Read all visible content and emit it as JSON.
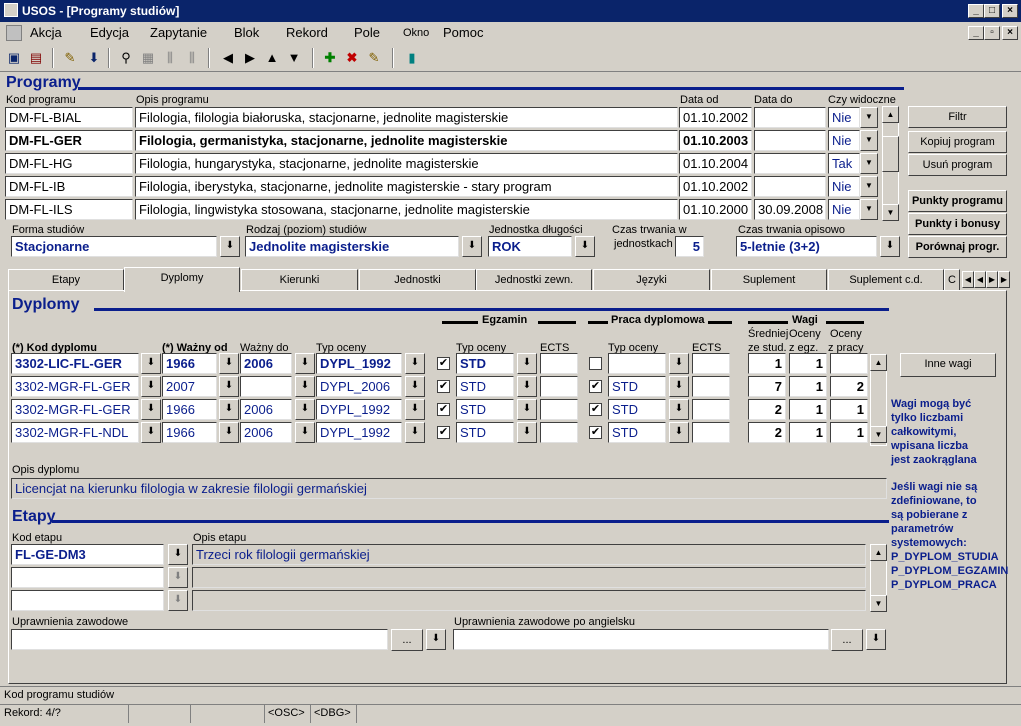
{
  "window": {
    "title": "USOS - [Programy studiów]"
  },
  "menu": [
    "Akcja",
    "Edycja",
    "Zapytanie",
    "Blok",
    "Rekord",
    "Pole",
    "Okno",
    "Pomoc"
  ],
  "programy": {
    "title": "Programy",
    "col_kod": "Kod programu",
    "col_opis": "Opis programu",
    "col_data_od": "Data od",
    "col_data_do": "Data do",
    "col_widoczne": "Czy widoczne",
    "rows": [
      {
        "kod": "DM-FL-BIAL",
        "opis": "Filologia, filologia białoruska, stacjonarne, jednolite magisterskie",
        "od": "01.10.2002",
        "do": "",
        "wid": "Nie"
      },
      {
        "kod": "DM-FL-GER",
        "opis": "Filologia, germanistyka, stacjonarne, jednolite magisterskie",
        "od": "01.10.2003",
        "do": "",
        "wid": "Nie"
      },
      {
        "kod": "DM-FL-HG",
        "opis": "Filologia, hungarystyka, stacjonarne, jednolite magisterskie",
        "od": "01.10.2004",
        "do": "",
        "wid": "Tak"
      },
      {
        "kod": "DM-FL-IB",
        "opis": "Filologia, iberystyka, stacjonarne, jednolite magisterskie - stary program",
        "od": "01.10.2002",
        "do": "",
        "wid": "Nie"
      },
      {
        "kod": "DM-FL-ILS",
        "opis": "Filologia, lingwistyka stosowana, stacjonarne, jednolite magisterskie",
        "od": "01.10.2000",
        "do": "30.09.2008",
        "wid": "Nie"
      }
    ],
    "buttons": {
      "filtr": "Filtr",
      "kopiuj": "Kopiuj program",
      "usun": "Usuń program",
      "punkty": "Punkty programu",
      "bonusy": "Punkty i bonusy",
      "porownaj": "Porównaj progr."
    },
    "forma_label": "Forma studiów",
    "forma": "Stacjonarne",
    "rodzaj_label": "Rodzaj (poziom) studiów",
    "rodzaj": "Jednolite magisterskie",
    "jedn_label": "Jednostka długości",
    "jedn": "ROK",
    "czas_label1": "Czas trwania w",
    "czas_label2": "jednostkach",
    "czas": "5",
    "czas_op_label": "Czas trwania opisowo",
    "czas_op": "5-letnie (3+2)"
  },
  "tabs": [
    "Etapy",
    "Dyplomy",
    "Kierunki",
    "Jednostki",
    "Jednostki zewn.",
    "Języki",
    "Suplement",
    "Suplement c.d.",
    "C"
  ],
  "dyplomy": {
    "title": "Dyplomy",
    "egzamin": "Egzamin",
    "praca": "Praca dyplomowa",
    "wagi": "Wagi",
    "h_kod": "(*) Kod dyplomu",
    "h_wazny_od": "(*) Ważny od",
    "h_wazny_do": "Ważny do",
    "h_typ": "Typ oceny",
    "h_typ_eg": "Typ oceny",
    "h_ects_eg": "ECTS",
    "h_typ_pr": "Typ oceny",
    "h_ects_pr": "ECTS",
    "h_w1a": "Średniej",
    "h_w1b": "ze stud.",
    "h_w2a": "Oceny",
    "h_w2b": "z egz.",
    "h_w3a": "Oceny",
    "h_w3b": "z pracy",
    "rows": [
      {
        "kod": "3302-LIC-FL-GER",
        "od": "1966",
        "do": "2006",
        "typ": "DYPL_1992",
        "eg": "STD",
        "ects1": "",
        "pr_chk": "",
        "pr": "",
        "ects2": "",
        "w1": "1",
        "w2": "1",
        "w3": ""
      },
      {
        "kod": "3302-MGR-FL-GER",
        "od": "2007",
        "do": "",
        "typ": "DYPL_2006",
        "eg": "STD",
        "ects1": "",
        "pr_chk": "✔",
        "pr": "STD",
        "ects2": "",
        "w1": "7",
        "w2": "1",
        "w3": "2"
      },
      {
        "kod": "3302-MGR-FL-GER",
        "od": "1966",
        "do": "2006",
        "typ": "DYPL_1992",
        "eg": "STD",
        "ects1": "",
        "pr_chk": "✔",
        "pr": "STD",
        "ects2": "",
        "w1": "2",
        "w2": "1",
        "w3": "1"
      },
      {
        "kod": "3302-MGR-FL-NDL",
        "od": "1966",
        "do": "2006",
        "typ": "DYPL_1992",
        "eg": "STD",
        "ects1": "",
        "pr_chk": "✔",
        "pr": "STD",
        "ects2": "",
        "w1": "2",
        "w2": "1",
        "w3": "1"
      }
    ],
    "inne_wagi": "Inne wagi",
    "note1": [
      "Wagi mogą być",
      "tylko liczbami",
      "całkowitymi,",
      "wpisana liczba",
      "jest zaokrąglana"
    ],
    "note2": [
      "Jeśli wagi nie są",
      "zdefiniowane, to",
      "są pobierane z",
      "parametrów",
      "systemowych:",
      "P_DYPLOM_STUDIA",
      "P_DYPLOM_EGZAMIN",
      "P_DYPLOM_PRACA"
    ],
    "opis_label": "Opis dyplomu",
    "opis": "Licencjat na kierunku filologia w zakresie filologii germańskiej"
  },
  "etapy": {
    "title": "Etapy",
    "kod_label": "Kod etapu",
    "opis_label": "Opis etapu",
    "rows": [
      {
        "kod": "FL-GE-DM3",
        "opis": "Trzeci rok filologii germańskiej"
      },
      {
        "kod": "",
        "opis": ""
      },
      {
        "kod": "",
        "opis": ""
      }
    ],
    "upr_label": "Uprawnienia zawodowe",
    "upr_en_label": "Uprawnienia zawodowe po angielsku",
    "dots": "..."
  },
  "status": {
    "hint": "Kod programu studiów",
    "rekord": "Rekord: 4/?",
    "osc": "<OSC>",
    "dbg": "<DBG>"
  }
}
